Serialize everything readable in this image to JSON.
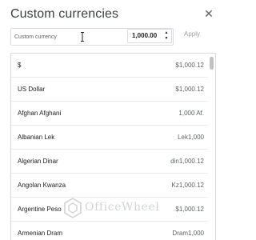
{
  "dialog": {
    "title": "Custom currencies",
    "close_icon": "close-icon"
  },
  "search": {
    "placeholder": "Custom currency",
    "value": ""
  },
  "amount_stepper": {
    "value": "1,000.00",
    "arrows": "▲▼"
  },
  "apply_button": {
    "label": "Apply",
    "enabled": false
  },
  "currencies": [
    {
      "name": "$",
      "amount": "$1,000.12"
    },
    {
      "name": "US Dollar",
      "amount": "$1,000.12"
    },
    {
      "name": "Afghan Afghani",
      "amount": "1,000 Af."
    },
    {
      "name": "Albanian Lek",
      "amount": "Lek1,000"
    },
    {
      "name": "Algerian Dinar",
      "amount": "din1,000.12"
    },
    {
      "name": "Angolan Kwanza",
      "amount": "Kz1,000.12"
    },
    {
      "name": "Argentine Peso",
      "amount": "$1,000.12"
    },
    {
      "name": "Armenian Dram",
      "amount": "Dram1,000"
    }
  ],
  "watermark": {
    "text": "OfficeWheel"
  },
  "colors": {
    "border": "#dadce0",
    "text": "#202124",
    "muted": "#5f6368",
    "disabled": "#9aa0a6"
  }
}
